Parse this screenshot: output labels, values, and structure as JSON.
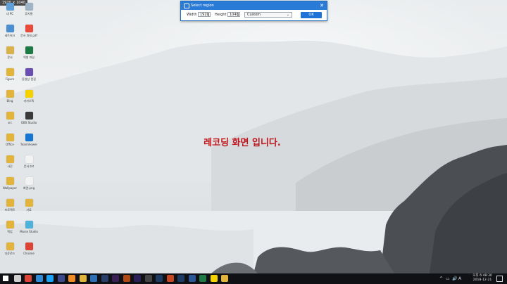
{
  "overlay": {
    "resolution_label": "1920 × 1040"
  },
  "dialog": {
    "title": "Select region",
    "width_label": "Width",
    "width_value": "1920",
    "height_label": "Height",
    "height_value": "1040",
    "preset_value": "Custom",
    "ok_label": "OK"
  },
  "desktop": {
    "center_text": "레코딩 화면 입니다.",
    "icons": [
      {
        "label": "내 PC",
        "color": "#5fa0d8"
      },
      {
        "label": "휴지통",
        "color": "#9fb4c4"
      },
      {
        "label": "네트워크",
        "color": "#4b8fd0"
      },
      {
        "label": "문서 파일.pdf",
        "color": "#e84b3c"
      },
      {
        "label": "문서",
        "color": "#d9b24a"
      },
      {
        "label": "엑셀 파일",
        "color": "#1e7a44"
      },
      {
        "label": "Figure",
        "color": "#e3b43b"
      },
      {
        "label": "동영상 편집",
        "color": "#6a4fb0"
      },
      {
        "label": "Bing",
        "color": "#e3b43b"
      },
      {
        "label": "카카오톡",
        "color": "#f5d100"
      },
      {
        "label": "src",
        "color": "#e3b43b"
      },
      {
        "label": "OBS Studio",
        "color": "#3a3a3a"
      },
      {
        "label": "Office",
        "color": "#e3b43b"
      },
      {
        "label": "TeamViewer",
        "color": "#1676d2"
      },
      {
        "label": "사진",
        "color": "#e3b43b"
      },
      {
        "label": "문서.txt",
        "color": "#f2f2f2"
      },
      {
        "label": "Wallpaper",
        "color": "#e3b43b"
      },
      {
        "label": "화면.png",
        "color": "#f2f2f2"
      },
      {
        "label": "프로젝트",
        "color": "#e3b43b"
      },
      {
        "label": "자료",
        "color": "#e3b43b"
      },
      {
        "label": "백업",
        "color": "#e3b43b"
      },
      {
        "label": "Movie Studio",
        "color": "#4fb3d9"
      },
      {
        "label": "다운로드",
        "color": "#e3b43b"
      },
      {
        "label": "Chrome",
        "color": "#db4437"
      }
    ]
  },
  "taskbar": {
    "apps": [
      {
        "name": "start",
        "color": "#ffffff"
      },
      {
        "name": "search",
        "color": "#cfcfcf"
      },
      {
        "name": "chrome",
        "color": "#db4437"
      },
      {
        "name": "edge",
        "color": "#2f8ad8"
      },
      {
        "name": "twitter",
        "color": "#1da1f2"
      },
      {
        "name": "bar-app",
        "color": "#3c4a8c"
      },
      {
        "name": "sublime",
        "color": "#f08a24"
      },
      {
        "name": "explorer",
        "color": "#e3b43b"
      },
      {
        "name": "app-blue",
        "color": "#2d6fb6"
      },
      {
        "name": "photoshop",
        "color": "#2a3e6a"
      },
      {
        "name": "premiere",
        "color": "#3b1e56"
      },
      {
        "name": "illustrator",
        "color": "#b04a12"
      },
      {
        "name": "after-effects",
        "color": "#2b1f5a"
      },
      {
        "name": "obs",
        "color": "#444444"
      },
      {
        "name": "photoshop-2",
        "color": "#1f3a63"
      },
      {
        "name": "powerpoint",
        "color": "#c64722"
      },
      {
        "name": "photoshop-3",
        "color": "#1f3a63"
      },
      {
        "name": "word",
        "color": "#2b5797"
      },
      {
        "name": "excel",
        "color": "#1e7a44"
      },
      {
        "name": "kakaotalk",
        "color": "#f5d100"
      },
      {
        "name": "explorer-2",
        "color": "#e3b43b"
      }
    ],
    "tray_icons": [
      "^",
      "▭",
      "🔊",
      "A"
    ],
    "clock_line1": "오후 6:48:30",
    "clock_line2": "2018-12-21"
  }
}
